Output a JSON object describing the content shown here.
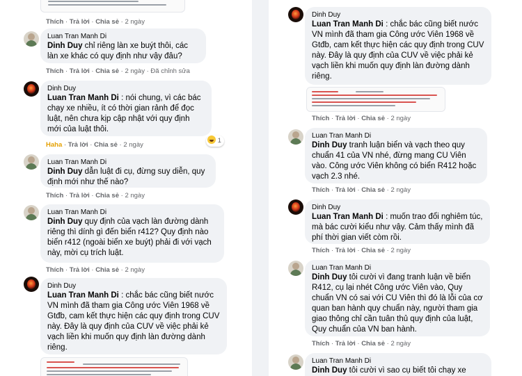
{
  "left": {
    "top_actions": {
      "like": "Thích",
      "reply": "Trả lời",
      "share": "Chia sẻ",
      "time": "2 ngày"
    },
    "comments": [
      {
        "author": "Luan Tran Manh Di",
        "mention": "Dinh Duy",
        "text": " chỉ riêng làn xe buýt thôi, các làn xe khác có quy định như vậy đâu?",
        "like": "Thích",
        "reply": "Trả lời",
        "share": "Chia sẻ",
        "time": "2 ngày",
        "edited": "Đã chỉnh sửa"
      },
      {
        "author": "Dinh Duy",
        "mention": "Luan Tran Manh Di",
        "text": " : nói chung, vì các bác chạy xe nhiều, ít có thời gian rảnh để đọc luật, nên chưa kịp cập nhật với quy định mới của luật thôi.",
        "reaction_label": "Haha",
        "reply": "Trả lời",
        "share": "Chia sẻ",
        "time": "2 ngày",
        "reaction_count": "1"
      },
      {
        "author": "Luan Tran Manh Di",
        "mention": "Dinh Duy",
        "text": " dẫn luật đi cụ, đừng suy diễn, quy định mới như thế nào?",
        "like": "Thích",
        "reply": "Trả lời",
        "share": "Chia sẻ",
        "time": "2 ngày"
      },
      {
        "author": "Luan Tran Manh Di",
        "mention": "Dinh Duy",
        "text": " quy định của vạch làn đường dành riêng thì dính gì đến biển r412? Quy định nào biển r412 (ngoài biển xe buýt) phải đi với vạch này, mời cụ trích luật.",
        "like": "Thích",
        "reply": "Trả lời",
        "share": "Chia sẻ",
        "time": "2 ngày"
      },
      {
        "author": "Dinh Duy",
        "mention": "Luan Tran Manh Di",
        "text": " : chắc bác cũng biết nước VN mình đã tham gia Công ước Viên 1968 về Gtđb, cam kết thực hiện các quy định trong CUV này. Đây là quy định của CUV về việc phải kẻ vạch liền khi muốn quy định làn đường dành riêng."
      }
    ]
  },
  "right": {
    "comments": [
      {
        "author": "Dinh Duy",
        "mention": "Luan Tran Manh Di",
        "text": " : chắc bác cũng biết nước VN mình đã tham gia Công ước Viên 1968 về Gtđb, cam kết thực hiện các quy định trong CUV này. Đây là quy định của CUV về việc phải kẻ vạch liền khi muốn quy định làn đường dành riêng.",
        "like": "Thích",
        "reply": "Trả lời",
        "share": "Chia sẻ",
        "time": "2 ngày"
      },
      {
        "author": "Luan Tran Manh Di",
        "mention": "Dinh Duy",
        "text": " tranh luận biển và vạch theo quy chuẩn 41 của VN nhé, đừng mang CU Viên vào. Công ước Viên không có biển R412 hoặc vạch 2.3 nhé.",
        "like": "Thích",
        "reply": "Trả lời",
        "share": "Chia sẻ",
        "time": "2 ngày"
      },
      {
        "author": "Dinh Duy",
        "mention": "Luan Tran Manh Di",
        "text": " : muốn trao đổi nghiêm túc, mà bác cười kiểu như vậy. Cảm thấy mình đã phí thời gian viết còm rồi.",
        "like": "Thích",
        "reply": "Trả lời",
        "share": "Chia sẻ",
        "time": "2 ngày"
      },
      {
        "author": "Luan Tran Manh Di",
        "mention": "Dinh Duy",
        "text": " tôi cười vì đang tranh luận về biển R412, cụ lại nhét Công ước Viên vào, Quy chuẩn VN có sai với CU Viên thì đó là lỗi của cơ quan ban hành quy chuẩn này, người tham gia giao thông chỉ cần tuân thủ quy định của luật, Quy chuẩn của VN ban hành.",
        "like": "Thích",
        "reply": "Trả lời",
        "share": "Chia sẻ",
        "time": "2 ngày"
      },
      {
        "author": "Luan Tran Manh Di",
        "mention": "Dinh Duy",
        "text": " tôi cười vì sao cụ biết tôi chạy xe"
      }
    ]
  },
  "colors": {
    "bubble": "#f0f2f5",
    "meta": "#65676b",
    "haha": "#e5a000",
    "text": "#050505"
  },
  "icons": {
    "luan_avatar": "profile-photo",
    "dinh_avatar": "fire-avatar",
    "reaction": "haha-emoji"
  }
}
